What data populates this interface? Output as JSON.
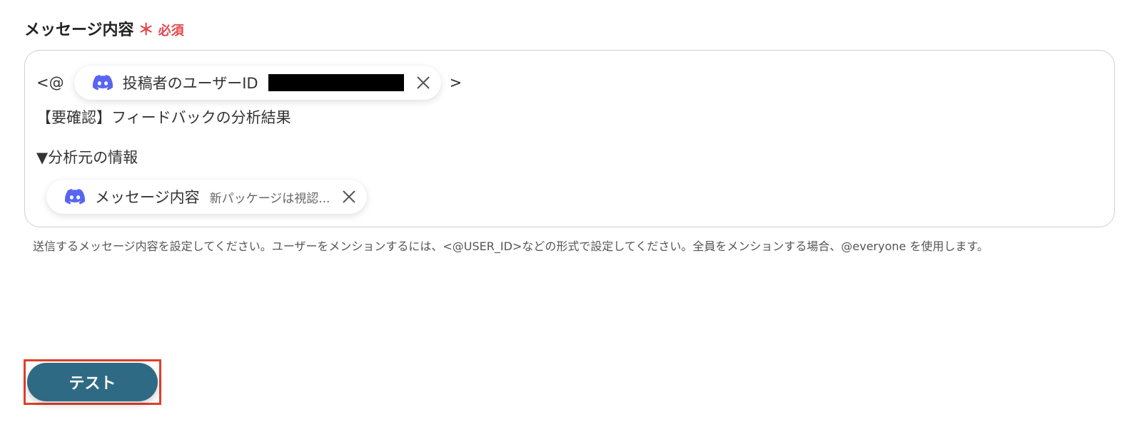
{
  "field": {
    "label": "メッセージ内容",
    "asterisk": "＊",
    "required": "必須"
  },
  "editor": {
    "line1_prefix": "<@",
    "line1_suffix": ">",
    "line2": "【要確認】フィードバックの分析結果",
    "line3": "▼分析元の情報",
    "chip_user": {
      "icon": "discord-icon",
      "label": "投稿者のユーザーID"
    },
    "chip_message": {
      "icon": "discord-icon",
      "label": "メッセージ内容",
      "preview": "新パッケージは視認..."
    }
  },
  "helper_text": "送信するメッセージ内容を設定してください。ユーザーをメンションするには、<@USER_ID>などの形式で設定してください。全員をメンションする場合、@everyone を使用します。",
  "test_button": {
    "label": "テスト"
  },
  "colors": {
    "required": "#e5484d",
    "discord": "#5865F2",
    "button": "#2f6a84",
    "highlight": "#e0402a"
  }
}
